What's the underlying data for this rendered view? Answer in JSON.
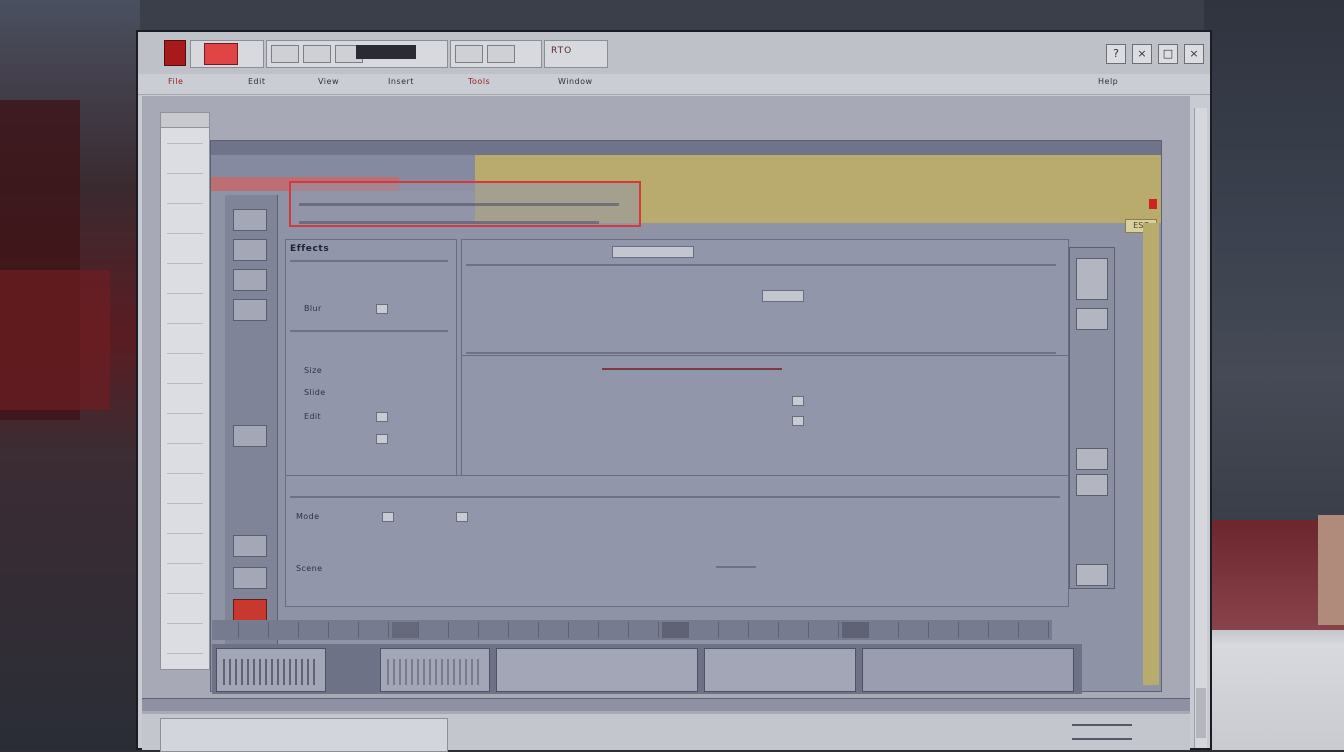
{
  "window": {
    "toolbar_label": "RTO",
    "controls": [
      "?",
      "×",
      "□",
      "×"
    ]
  },
  "menu": {
    "items": [
      "File",
      "Edit",
      "View",
      "Insert",
      "Tools",
      "Window",
      "Help"
    ]
  },
  "document": {
    "title": "",
    "right_note": "",
    "red_tab_label": "",
    "yellow_tag": "ESC"
  },
  "selection": {
    "line1": "",
    "line2": ""
  },
  "panes": {
    "left_head": "Effects",
    "left_rows": [
      "Blur",
      "Size",
      "Slide",
      "Edit"
    ],
    "left_head2": "",
    "left_rows2": [
      "Mode",
      "Scene"
    ],
    "right_head": "",
    "right_rows": []
  },
  "thumbs": [
    ""
  ],
  "status": {
    "text": ""
  },
  "bottom": {
    "left_label": "",
    "right_label": ""
  },
  "colors": {
    "accent_red": "#d43a3a",
    "band_yellow": "#b9aa6d",
    "panel": "#9296aa"
  }
}
